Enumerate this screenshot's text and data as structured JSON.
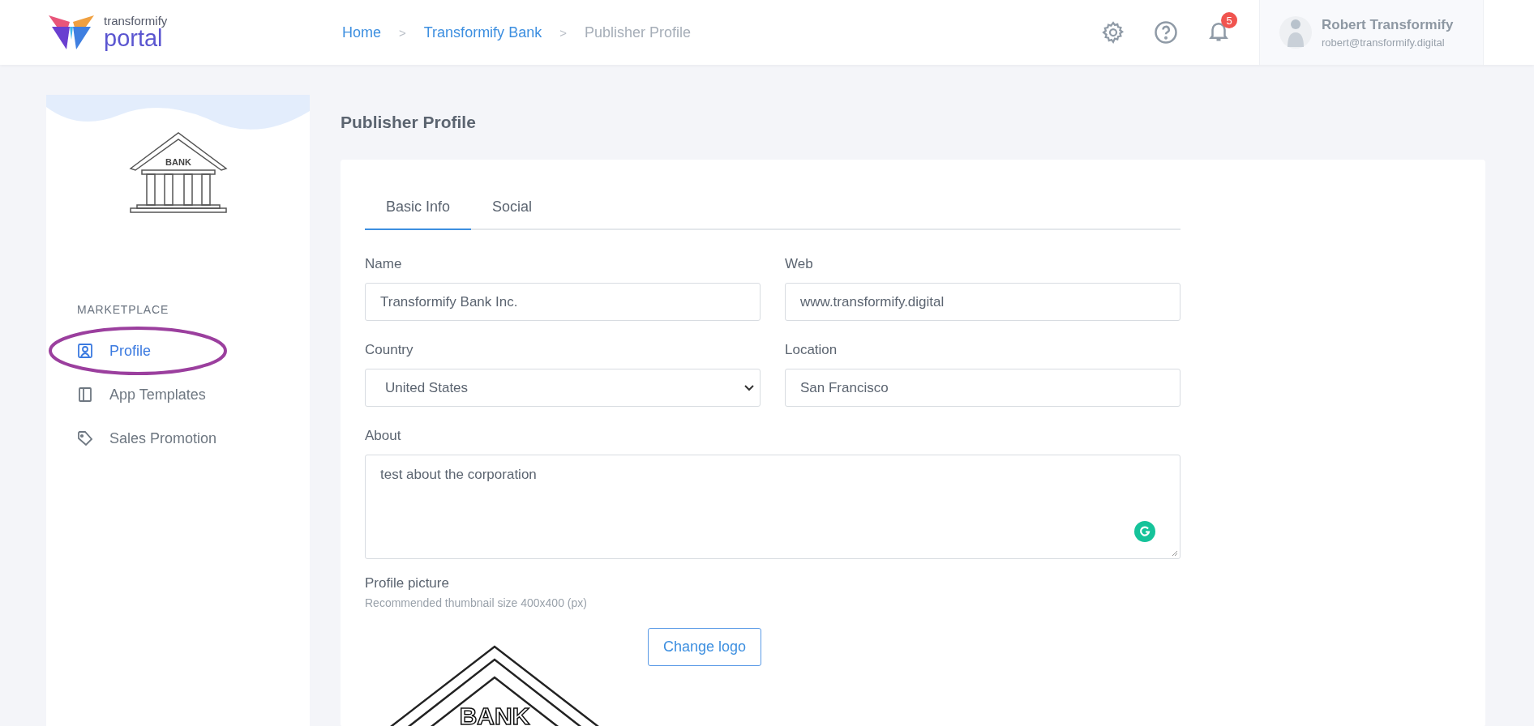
{
  "header": {
    "logo": {
      "small": "transformify",
      "large": "portal"
    },
    "breadcrumb": [
      {
        "label": "Home",
        "current": false
      },
      {
        "label": "Transformify Bank",
        "current": false
      },
      {
        "label": "Publisher Profile",
        "current": true
      }
    ],
    "separator": ">",
    "notifications": {
      "count": "5"
    },
    "user": {
      "name": "Robert Transformify",
      "email": "robert@transformify.digital"
    }
  },
  "sidebar": {
    "logo_text": "BANK",
    "section": "MARKETPLACE",
    "items": [
      {
        "label": "Profile",
        "selected": true,
        "kind": "profile",
        "circled": true
      },
      {
        "label": "App Templates",
        "selected": false,
        "kind": "templates",
        "circled": false
      },
      {
        "label": "Sales Promotion",
        "selected": false,
        "kind": "tag",
        "circled": false
      }
    ]
  },
  "page": {
    "title": "Publisher Profile",
    "tabs": [
      {
        "label": "Basic Info",
        "selected": true
      },
      {
        "label": "Social",
        "selected": false
      }
    ],
    "fields": [
      {
        "label": "Name",
        "value": "Transformify Bank Inc.",
        "kind": "text"
      },
      {
        "label": "Web",
        "value": "www.transformify.digital",
        "kind": "text"
      },
      {
        "label": "Country",
        "value": "United States",
        "kind": "select"
      },
      {
        "label": "Location",
        "value": "San Francisco",
        "kind": "text"
      }
    ],
    "about": {
      "label": "About",
      "value": "test about the corporation"
    },
    "picture": {
      "label": "Profile picture",
      "hint": "Recommended thumbnail size 400x400 (px)",
      "image_text": "BANK",
      "button": "Change logo"
    }
  }
}
